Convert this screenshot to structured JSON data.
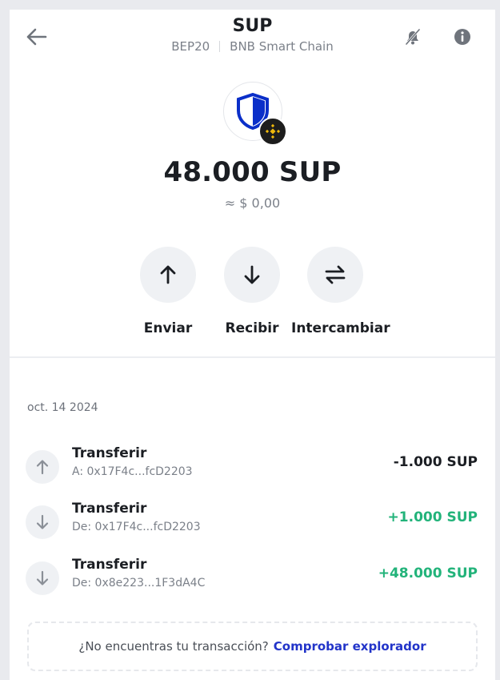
{
  "header": {
    "title": "SUP",
    "network": "BEP20",
    "chain": "BNB Smart Chain"
  },
  "token": {
    "balance": "48.000 SUP",
    "fiat": "≈ $ 0,00",
    "colors": {
      "shield": "#0b2fc9",
      "badge_bg": "#1d1d1d",
      "badge_accent": "#f0b90b"
    }
  },
  "actions": [
    {
      "label": "Enviar",
      "icon": "arrow-up-icon"
    },
    {
      "label": "Recibir",
      "icon": "arrow-down-icon"
    },
    {
      "label": "Intercambiar",
      "icon": "swap-icon"
    }
  ],
  "history": {
    "date": "oct. 14 2024",
    "transactions": [
      {
        "type": "Transferir",
        "address": "A: 0x17F4c...fcD2203",
        "amount": "-1.000 SUP",
        "direction": "out",
        "color": "#1b1e23",
        "icon": "arrow-up-icon"
      },
      {
        "type": "Transferir",
        "address": "De: 0x17F4c...fcD2203",
        "amount": "+1.000 SUP",
        "direction": "in",
        "color": "#22b37a",
        "icon": "arrow-down-icon"
      },
      {
        "type": "Transferir",
        "address": "De: 0x8e223...1F3dA4C",
        "amount": "+48.000 SUP",
        "direction": "in",
        "color": "#22b37a",
        "icon": "arrow-down-icon"
      }
    ]
  },
  "explorer": {
    "question": "¿No encuentras tu transacción?",
    "link": "Comprobar explorador",
    "link_color": "#2234c9"
  }
}
